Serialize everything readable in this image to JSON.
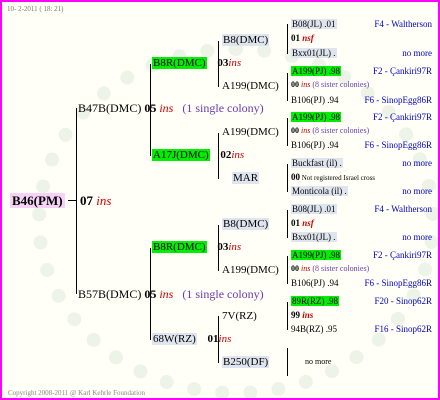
{
  "header_date": "10-  2-2011  ( 18: 21)",
  "copyright": "Copyright 2008-2011 @ Karl Kehrle Foundation",
  "root": {
    "name": "B46(PM)",
    "num": "07",
    "ins": "ins"
  },
  "father": {
    "name": "B47B(DMC)",
    "num": "05",
    "ins": "ins",
    "note": "(1 single colony)"
  },
  "mother": {
    "name": "B57B(DMC)",
    "num": "05",
    "ins": "ins",
    "note": "(1 single colony)"
  },
  "ff": {
    "name": "B8R(DMC)",
    "num": "03",
    "ins": "ins"
  },
  "fm": {
    "name": "A17J(DMC)",
    "num": "02",
    "ins": "ins"
  },
  "mf": {
    "name": "B8R(DMC)",
    "num": "03",
    "ins": "ins"
  },
  "mm": {
    "name": "68W(RZ)",
    "num": "01",
    "ins": "ins"
  },
  "g3": [
    {
      "name": "B8(DMC)"
    },
    {
      "name": "A199(DMC)"
    },
    {
      "name": "A199(DMC)"
    },
    {
      "name": "MAR"
    },
    {
      "name": "B8(DMC)"
    },
    {
      "name": "A199(DMC)"
    },
    {
      "name": "7V(RZ)"
    },
    {
      "name": "B250(DF)"
    }
  ],
  "g4": [
    {
      "c1": "B08(JL) .01",
      "c2": "F4 - Waltherson"
    },
    {
      "num": "01",
      "ins": "nsf"
    },
    {
      "c1": "Bxx01(JL) .",
      "c2": "no more"
    },
    {
      "c1": "A199(PJ) .98",
      "c2": "F2 - Çankiri97R"
    },
    {
      "num": "00",
      "ins": "ins",
      "note": "(8 sister colonies)"
    },
    {
      "c1": "B106(PJ) .94",
      "c2": "F6 - SinopEgg86R"
    },
    {
      "c1": "A199(PJ) .98",
      "c2": "F2 - Çankiri97R"
    },
    {
      "num": "00",
      "ins": "ins",
      "note": "(8 sister colonies)"
    },
    {
      "c1": "B106(PJ) .94",
      "c2": "F6 - SinopEgg86R"
    },
    {
      "c1": "Buckfast (il) .",
      "c2": "no more"
    },
    {
      "num": "00",
      "note": "Not registered Israel cross"
    },
    {
      "c1": "Monticola (il) .",
      "c2": "no more"
    },
    {
      "c1": "B08(JL) .01",
      "c2": "F4 - Waltherson"
    },
    {
      "num": "01",
      "ins": "nsf"
    },
    {
      "c1": "Bxx01(JL) .",
      "c2": "no more"
    },
    {
      "c1": "A199(PJ) .98",
      "c2": "F2 - Çankiri97R"
    },
    {
      "num": "00",
      "ins": "ins",
      "note": "(8 sister colonies)"
    },
    {
      "c1": "B106(PJ) .94",
      "c2": "F6 - SinopEgg86R"
    },
    {
      "c1": "89R(RZ) .98",
      "c2": "F20 - Sinop62R"
    },
    {
      "num": "99",
      "ins": "ins"
    },
    {
      "c1": "94B(RZ) .95",
      "c2": "F16 - Sinop62R"
    },
    {
      "note": "no more"
    }
  ]
}
